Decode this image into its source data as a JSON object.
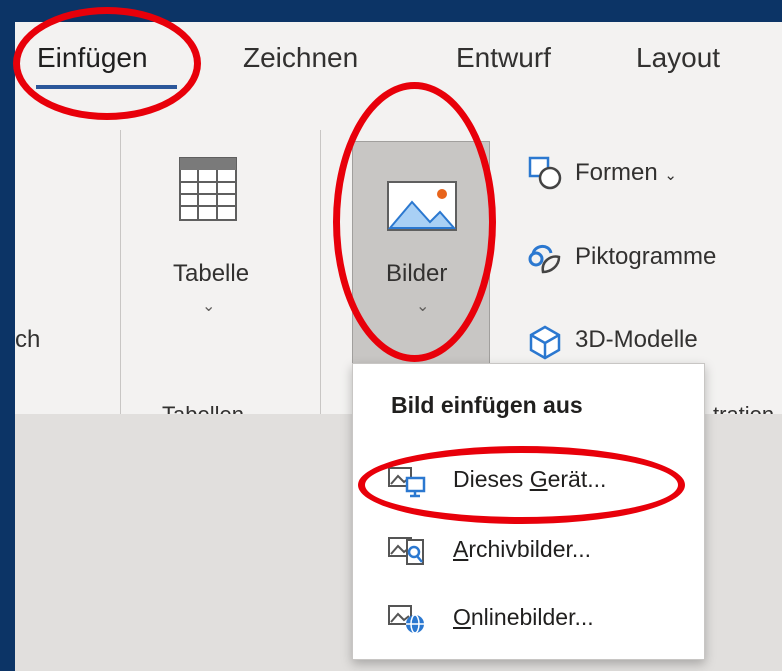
{
  "tabs": [
    {
      "label": "Einfügen",
      "active": true
    },
    {
      "label": "Zeichnen",
      "active": false
    },
    {
      "label": "Entwurf",
      "active": false
    },
    {
      "label": "Layout",
      "active": false
    }
  ],
  "ribbon": {
    "left_cut_text": "ch",
    "tabelle": {
      "label": "Tabelle",
      "group_label": "Tabellen"
    },
    "bilder": {
      "label": "Bilder"
    },
    "formen": {
      "label": "Formen"
    },
    "piktogramme": {
      "label": "Piktogramme"
    },
    "modelle3d": {
      "label": "3D-Modelle"
    },
    "illustrations_group_label_partial": "tration"
  },
  "dropdown": {
    "header": "Bild einfügen aus",
    "items": [
      {
        "pre": "Dieses ",
        "u": "G",
        "post": "erät...",
        "icon": "device-image-icon"
      },
      {
        "pre": "",
        "u": "A",
        "post": "rchivbilder...",
        "icon": "stock-image-icon"
      },
      {
        "pre": "",
        "u": "O",
        "post": "nlinebilder...",
        "icon": "online-image-icon"
      }
    ]
  },
  "colors": {
    "frame": "#0c3466",
    "ribbon": "#f3f2f1",
    "accent_underline": "#2b579a",
    "highlight_ellipse": "#e8000a",
    "icon_blue": "#2b78d0"
  }
}
